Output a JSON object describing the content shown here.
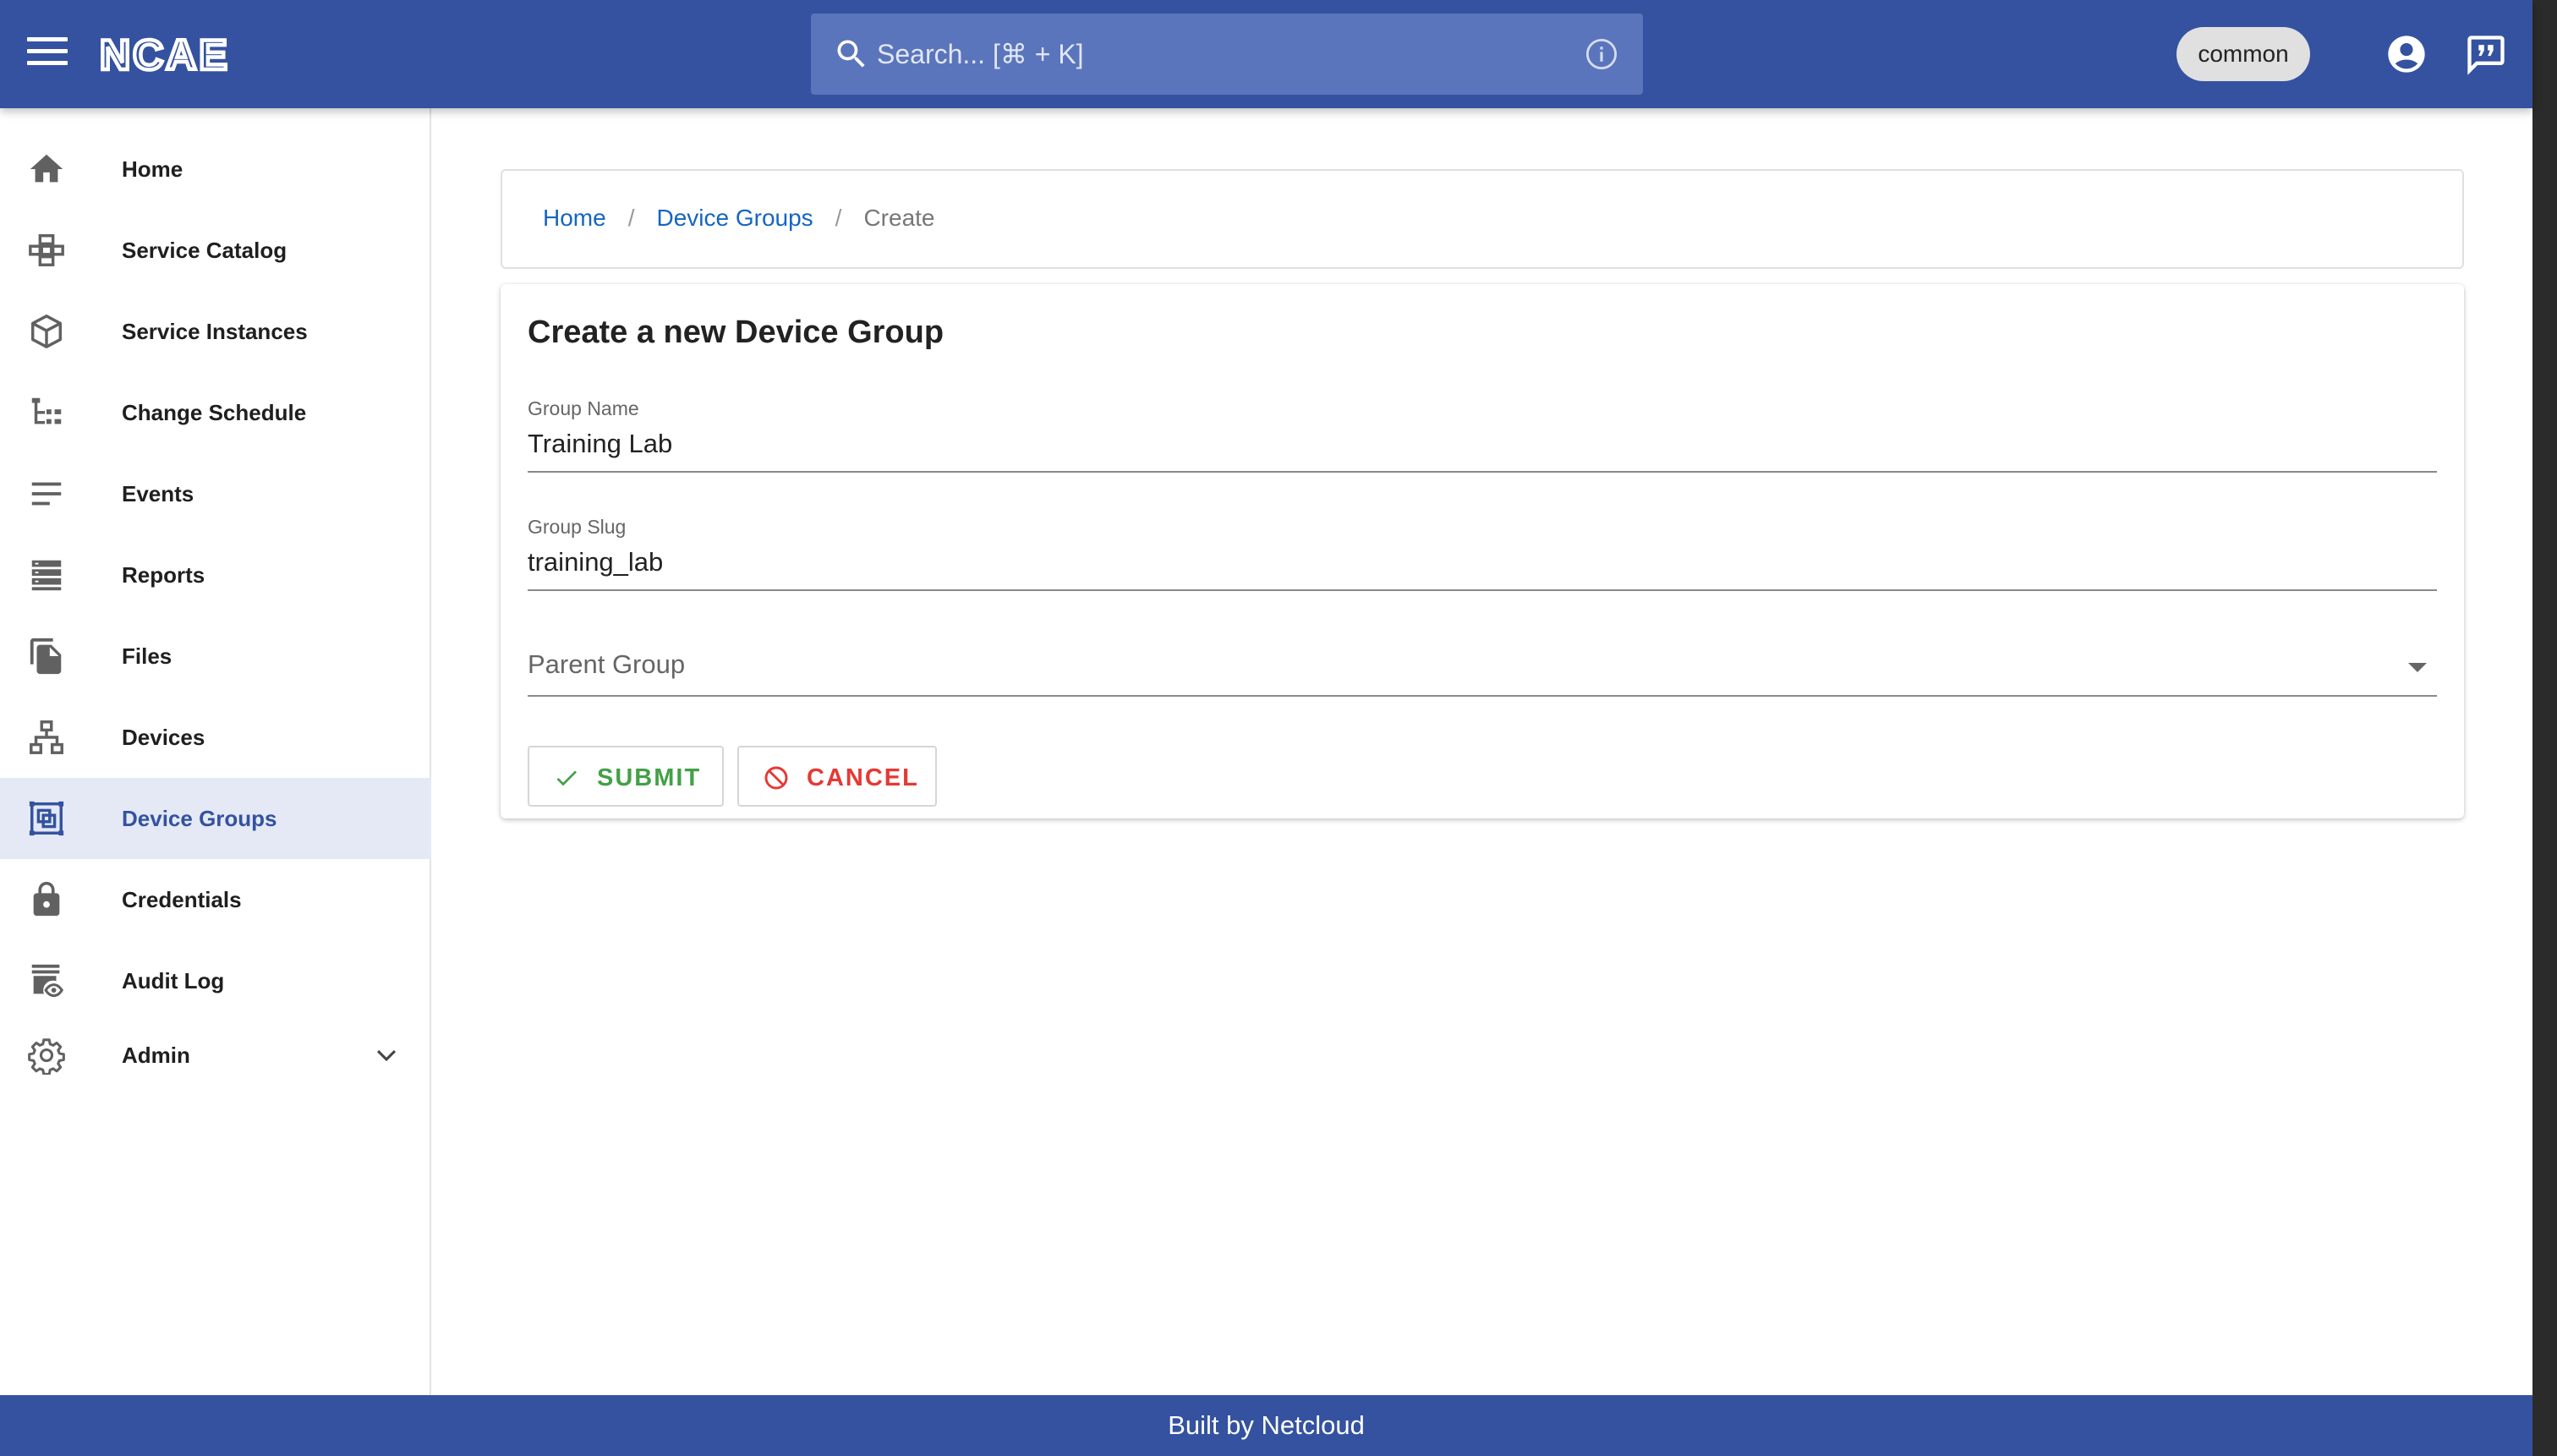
{
  "header": {
    "brand": "NCAE",
    "search_placeholder": "Search... [⌘ + K]",
    "workspace": "common"
  },
  "sidebar": {
    "items": [
      {
        "label": "Home",
        "icon": "home-icon"
      },
      {
        "label": "Service Catalog",
        "icon": "service-catalog-icon"
      },
      {
        "label": "Service Instances",
        "icon": "cube-icon"
      },
      {
        "label": "Change Schedule",
        "icon": "schedule-tree-icon"
      },
      {
        "label": "Events",
        "icon": "events-lines-icon"
      },
      {
        "label": "Reports",
        "icon": "reports-icon"
      },
      {
        "label": "Files",
        "icon": "files-icon"
      },
      {
        "label": "Devices",
        "icon": "devices-icon"
      },
      {
        "label": "Device Groups",
        "icon": "device-groups-icon",
        "active": true
      },
      {
        "label": "Credentials",
        "icon": "lock-icon"
      },
      {
        "label": "Audit Log",
        "icon": "audit-log-icon"
      },
      {
        "label": "Admin",
        "icon": "gear-icon"
      }
    ]
  },
  "breadcrumb": {
    "home": "Home",
    "sep": "/",
    "section": "Device Groups",
    "current": "Create"
  },
  "form": {
    "title": "Create a new Device Group",
    "group_name_label": "Group Name",
    "group_name_value": "Training Lab",
    "group_slug_label": "Group Slug",
    "group_slug_value": "training_lab",
    "parent_group_label": "Parent Group",
    "submit_label": "SUBMIT",
    "cancel_label": "CANCEL"
  },
  "footer": {
    "text": "Built by Netcloud"
  },
  "colors": {
    "primary": "#3452a0",
    "active_bg": "#e4e9f5",
    "link": "#1565c0",
    "submit": "#43a047",
    "cancel": "#e53935"
  }
}
